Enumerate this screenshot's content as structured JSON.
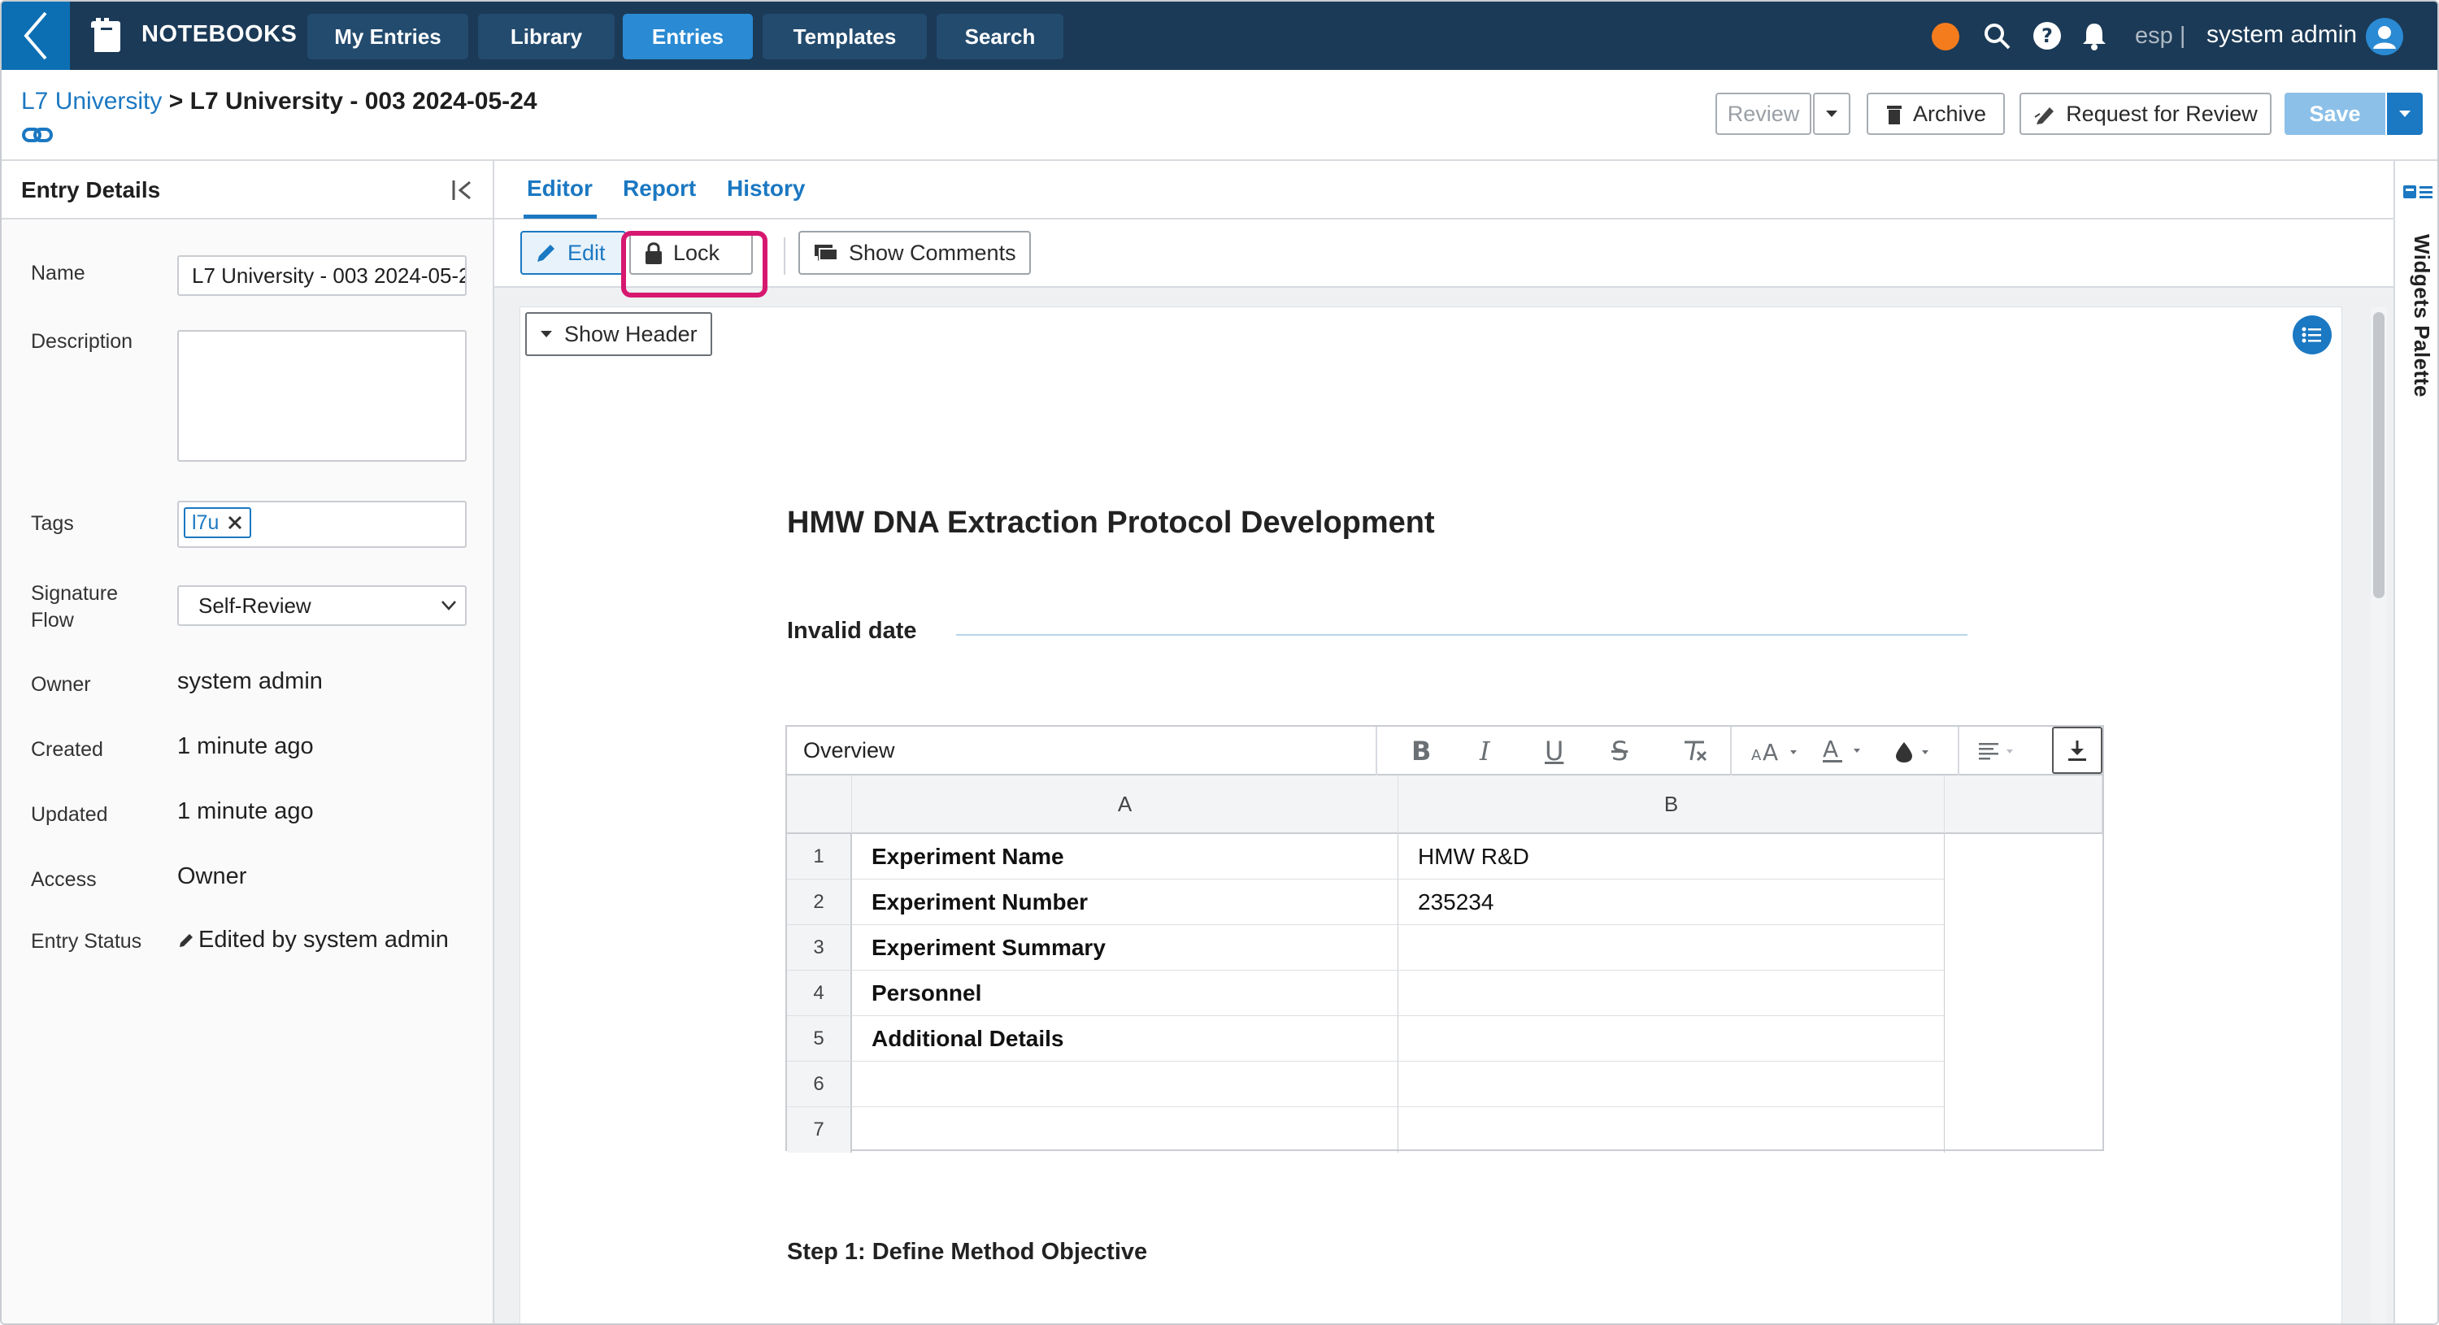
{
  "nav": {
    "brand": "NOTEBOOKS",
    "tabs": [
      {
        "label": "My Entries",
        "active": false
      },
      {
        "label": "Library",
        "active": false
      },
      {
        "label": "Entries",
        "active": true
      },
      {
        "label": "Templates",
        "active": false
      },
      {
        "label": "Search",
        "active": false
      }
    ],
    "language": "esp |",
    "user": "system admin",
    "icons": [
      "back-chevron-icon",
      "notebook-icon",
      "status-dot",
      "search-icon",
      "help-icon",
      "bell-icon",
      "user-avatar-icon"
    ]
  },
  "breadcrumb": {
    "parent": "L7 University",
    "separator": ">",
    "current": "L7 University - 003 2024-05-24"
  },
  "header_actions": {
    "review": "Review",
    "archive": "Archive",
    "request_review": "Request for Review",
    "save": "Save"
  },
  "entry_details": {
    "title": "Entry Details",
    "labels": {
      "name": "Name",
      "description": "Description",
      "tags": "Tags",
      "signature_flow_1": "Signature",
      "signature_flow_2": "Flow",
      "owner": "Owner",
      "created": "Created",
      "updated": "Updated",
      "access": "Access",
      "entry_status": "Entry Status"
    },
    "values": {
      "name": "L7 University - 003 2024-05-24",
      "description": "",
      "tag": "l7u",
      "signature_flow": "Self-Review",
      "owner": "system admin",
      "created": "1 minute ago",
      "updated": "1 minute ago",
      "access": "Owner",
      "entry_status": "Edited by system admin"
    }
  },
  "main_tabs": [
    {
      "label": "Editor",
      "active": true
    },
    {
      "label": "Report",
      "active": false
    },
    {
      "label": "History",
      "active": false
    }
  ],
  "toolbar": {
    "edit": "Edit",
    "lock": "Lock",
    "show_comments": "Show Comments"
  },
  "document": {
    "show_header": "Show Header",
    "title": "HMW DNA Extraction Protocol Development",
    "date_label": "Invalid date",
    "step1": "Step 1: Define Method Objective"
  },
  "sheet": {
    "name": "Overview",
    "columns": [
      "A",
      "B"
    ],
    "rows": [
      {
        "num": "1",
        "a": "Experiment Name",
        "b": "HMW R&D"
      },
      {
        "num": "2",
        "a": "Experiment Number",
        "b": "235234"
      },
      {
        "num": "3",
        "a": "Experiment Summary",
        "b": ""
      },
      {
        "num": "4",
        "a": "Personnel",
        "b": ""
      },
      {
        "num": "5",
        "a": "Additional Details",
        "b": ""
      },
      {
        "num": "6",
        "a": "",
        "b": ""
      },
      {
        "num": "7",
        "a": "",
        "b": ""
      }
    ]
  },
  "right_rail": {
    "label": "Widgets Palette"
  },
  "colors": {
    "nav_bg": "#1b3a57",
    "accent": "#1b78c2",
    "active_tab": "#2a8ad3",
    "highlight": "#d6186f",
    "status_dot": "#f47c1c"
  }
}
